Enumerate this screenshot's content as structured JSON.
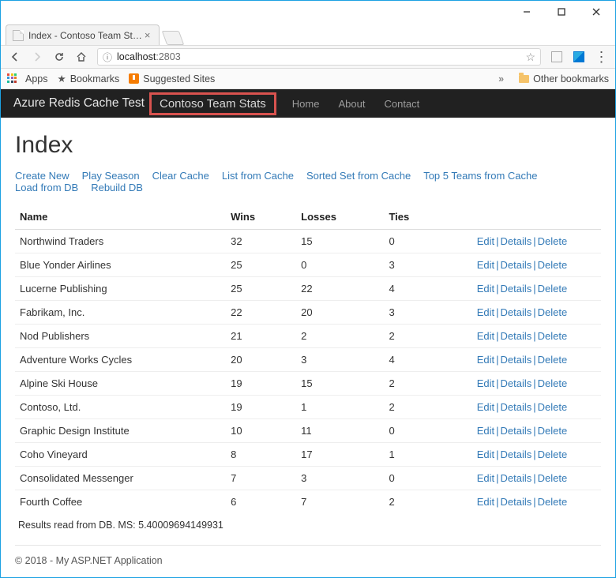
{
  "window": {
    "tab_title": "Index - Contoso Team St…"
  },
  "toolbar": {
    "host": "localhost",
    "port": ":2803",
    "apps_label": "Apps",
    "bookmarks_label": "Bookmarks",
    "suggested_label": "Suggested Sites",
    "more_label": "»",
    "other_label": "Other bookmarks"
  },
  "navbar": {
    "brand": "Azure Redis Cache Test",
    "highlight": "Contoso Team Stats",
    "links": [
      "Home",
      "About",
      "Contact"
    ]
  },
  "page": {
    "title": "Index",
    "actions": [
      "Create New",
      "Play Season",
      "Clear Cache",
      "List from Cache",
      "Sorted Set from Cache",
      "Top 5 Teams from Cache",
      "Load from DB",
      "Rebuild DB"
    ],
    "columns": [
      "Name",
      "Wins",
      "Losses",
      "Ties"
    ],
    "row_actions": {
      "edit": "Edit",
      "details": "Details",
      "delete": "Delete"
    },
    "rows": [
      {
        "name": "Northwind Traders",
        "wins": "32",
        "losses": "15",
        "ties": "0"
      },
      {
        "name": "Blue Yonder Airlines",
        "wins": "25",
        "losses": "0",
        "ties": "3"
      },
      {
        "name": "Lucerne Publishing",
        "wins": "25",
        "losses": "22",
        "ties": "4"
      },
      {
        "name": "Fabrikam, Inc.",
        "wins": "22",
        "losses": "20",
        "ties": "3"
      },
      {
        "name": "Nod Publishers",
        "wins": "21",
        "losses": "2",
        "ties": "2"
      },
      {
        "name": "Adventure Works Cycles",
        "wins": "20",
        "losses": "3",
        "ties": "4"
      },
      {
        "name": "Alpine Ski House",
        "wins": "19",
        "losses": "15",
        "ties": "2"
      },
      {
        "name": "Contoso, Ltd.",
        "wins": "19",
        "losses": "1",
        "ties": "2"
      },
      {
        "name": "Graphic Design Institute",
        "wins": "10",
        "losses": "11",
        "ties": "0"
      },
      {
        "name": "Coho Vineyard",
        "wins": "8",
        "losses": "17",
        "ties": "1"
      },
      {
        "name": "Consolidated Messenger",
        "wins": "7",
        "losses": "3",
        "ties": "0"
      },
      {
        "name": "Fourth Coffee",
        "wins": "6",
        "losses": "7",
        "ties": "2"
      }
    ],
    "status": "Results read from DB. MS: 5.40009694149931",
    "footer": "© 2018 - My ASP.NET Application"
  }
}
